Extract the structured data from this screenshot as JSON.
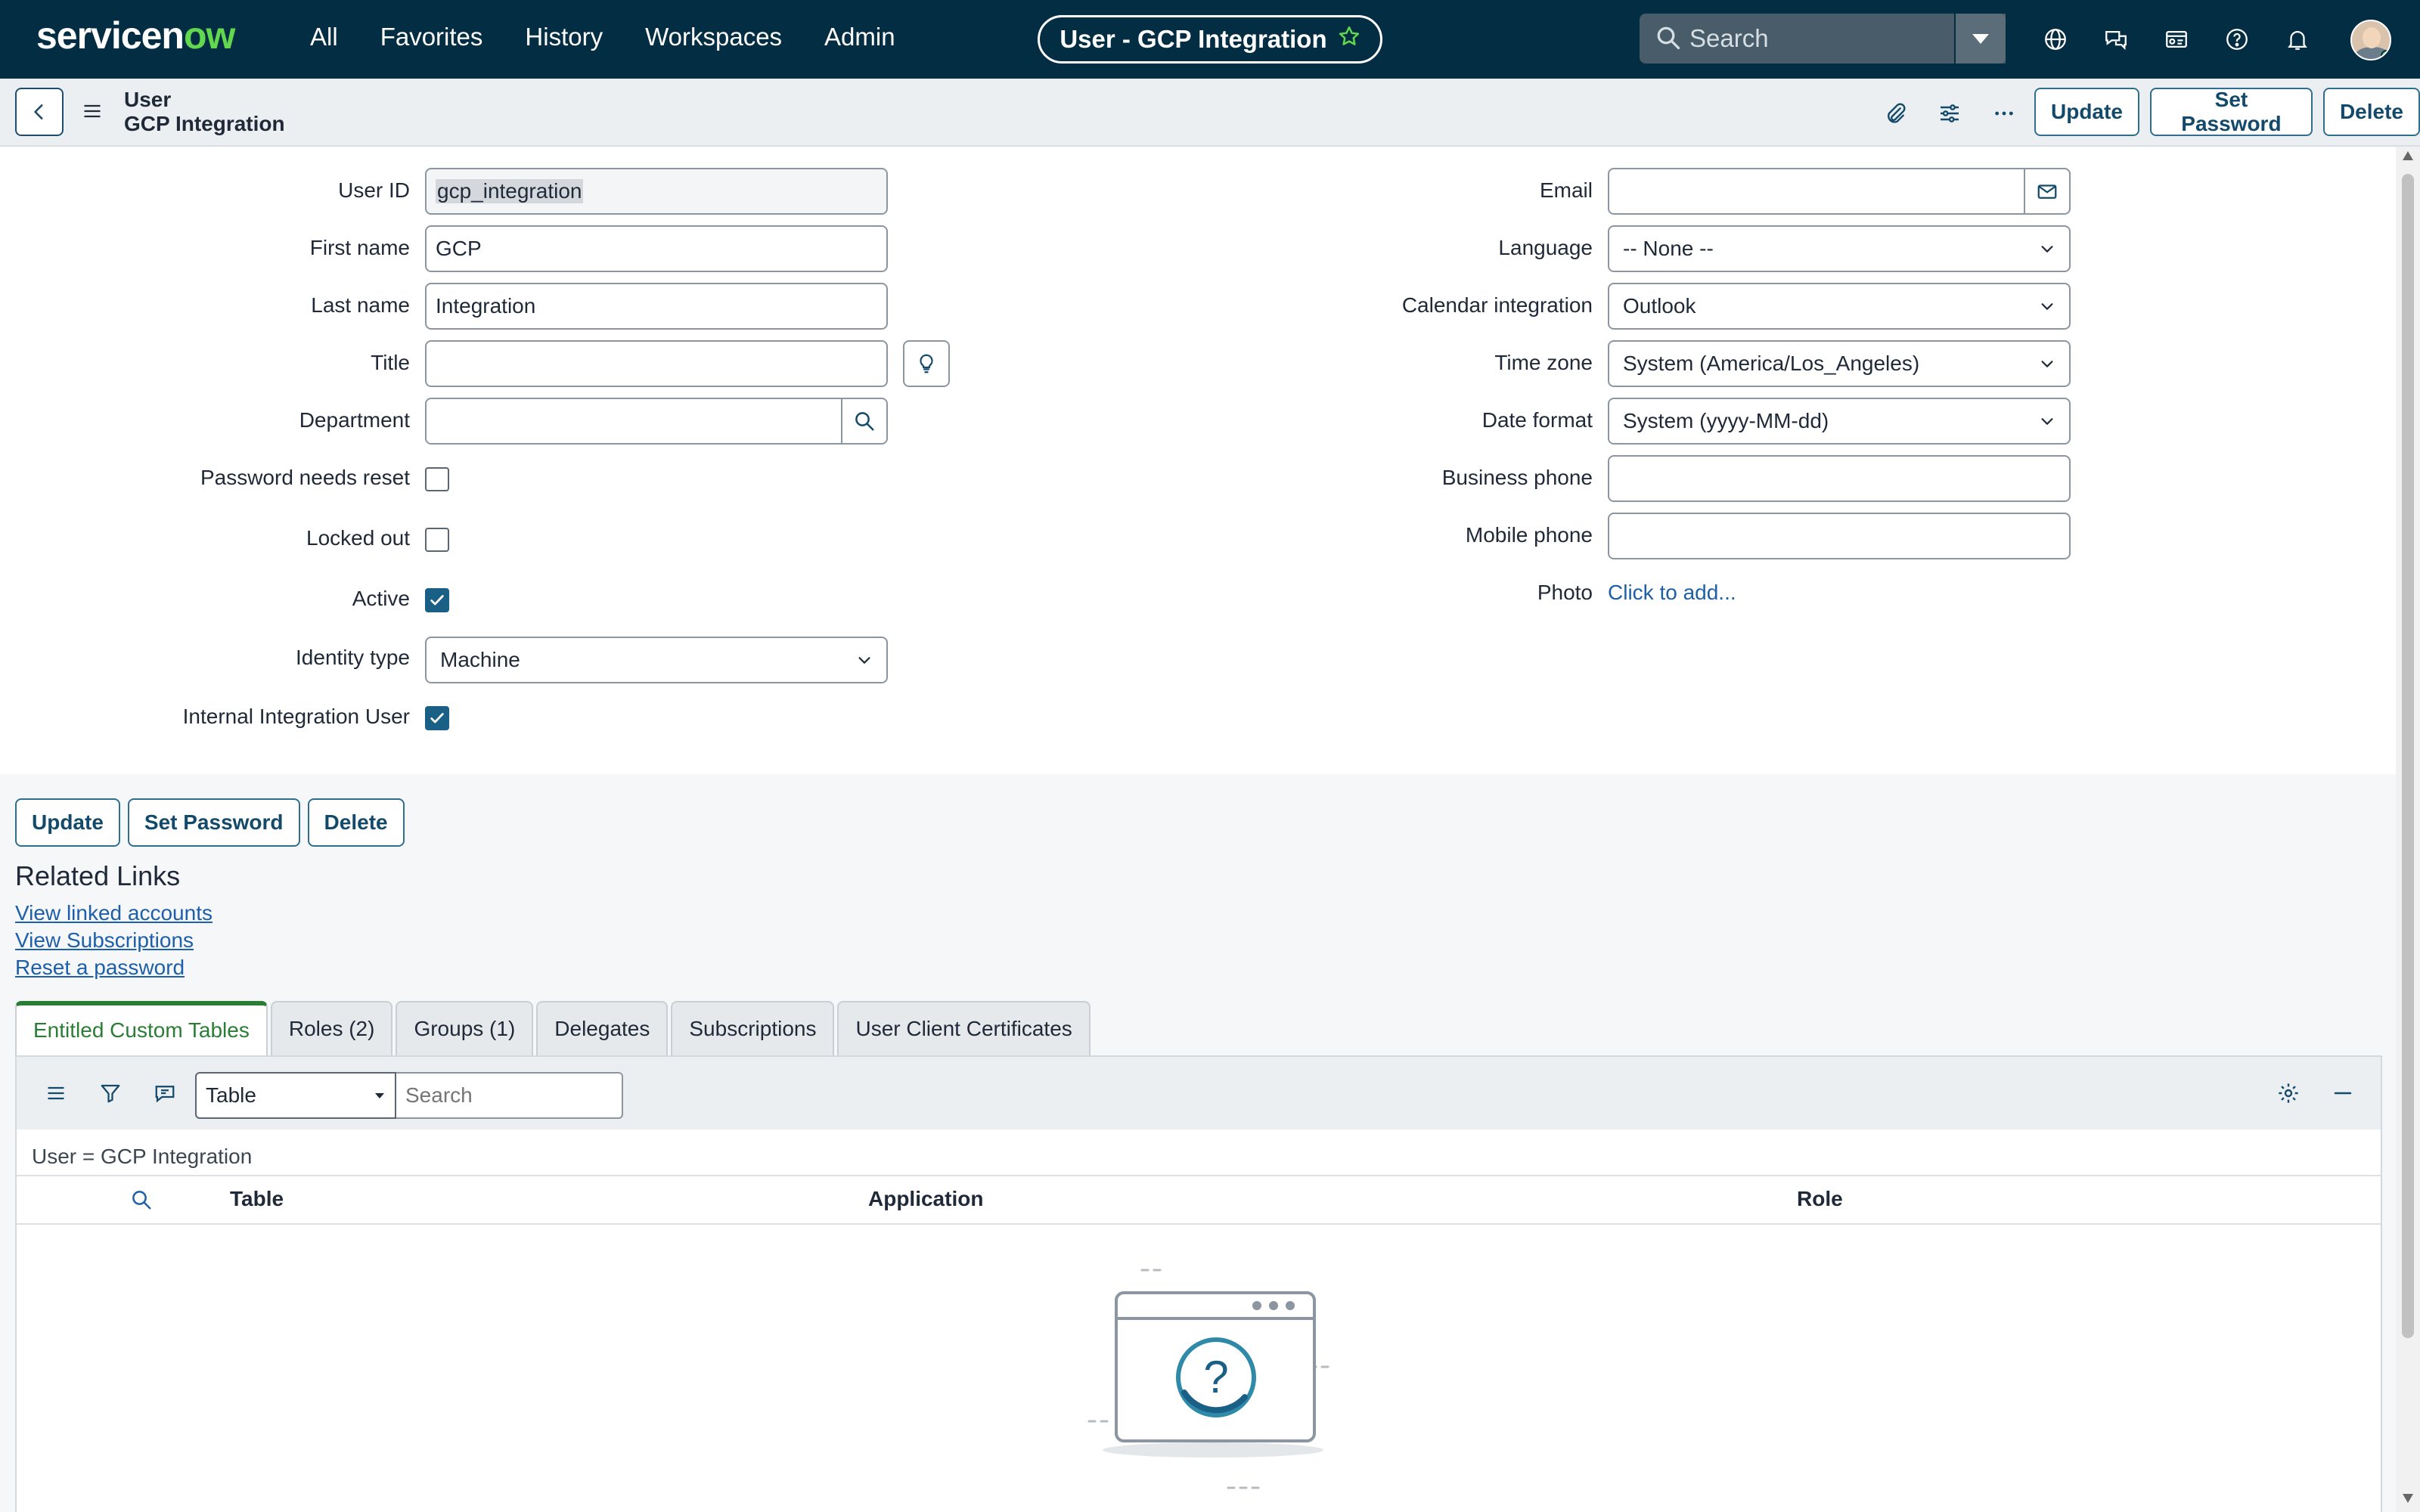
{
  "colors": {
    "nav_bg": "#032d42",
    "brand_green": "#62d84e",
    "link": "#1d5fa8",
    "active_tab": "#2b7d36"
  },
  "nav": {
    "logo_text_a": "servicen",
    "logo_text_b": "ow",
    "links": [
      "All",
      "Favorites",
      "History",
      "Workspaces",
      "Admin"
    ],
    "record_pill": "User - GCP Integration",
    "search_placeholder": "Search",
    "icons": [
      "globe-icon",
      "chat-icon",
      "id-card-icon",
      "help-icon",
      "bell-icon"
    ]
  },
  "header": {
    "record_type": "User",
    "record_name": "GCP Integration",
    "buttons": {
      "update": "Update",
      "set_password": "Set Password",
      "delete": "Delete"
    }
  },
  "form": {
    "left": {
      "user_id": {
        "label": "User ID",
        "value": "gcp_integration"
      },
      "first_name": {
        "label": "First name",
        "value": "GCP"
      },
      "last_name": {
        "label": "Last name",
        "value": "Integration"
      },
      "title": {
        "label": "Title",
        "value": ""
      },
      "department": {
        "label": "Department",
        "value": ""
      },
      "password_needs_reset": {
        "label": "Password needs reset",
        "checked": false
      },
      "locked_out": {
        "label": "Locked out",
        "checked": false
      },
      "active": {
        "label": "Active",
        "checked": true
      },
      "identity_type": {
        "label": "Identity type",
        "value": "Machine"
      },
      "internal_integration_user": {
        "label": "Internal Integration User",
        "checked": true
      }
    },
    "right": {
      "email": {
        "label": "Email",
        "value": ""
      },
      "language": {
        "label": "Language",
        "value": "-- None --"
      },
      "calendar_integration": {
        "label": "Calendar integration",
        "value": "Outlook"
      },
      "time_zone": {
        "label": "Time zone",
        "value": "System (America/Los_Angeles)"
      },
      "date_format": {
        "label": "Date format",
        "value": "System (yyyy-MM-dd)"
      },
      "business_phone": {
        "label": "Business phone",
        "value": ""
      },
      "mobile_phone": {
        "label": "Mobile phone",
        "value": ""
      },
      "photo": {
        "label": "Photo",
        "link": "Click to add..."
      }
    }
  },
  "footer_buttons": {
    "update": "Update",
    "set_password": "Set Password",
    "delete": "Delete"
  },
  "related_links": {
    "title": "Related Links",
    "links": [
      "View linked accounts",
      "View Subscriptions",
      "Reset a password"
    ]
  },
  "tabs": [
    {
      "label": "Entitled Custom Tables",
      "active": true
    },
    {
      "label": "Roles (2)",
      "active": false
    },
    {
      "label": "Groups (1)",
      "active": false
    },
    {
      "label": "Delegates",
      "active": false
    },
    {
      "label": "Subscriptions",
      "active": false
    },
    {
      "label": "User Client Certificates",
      "active": false
    }
  ],
  "list": {
    "filter_field": "Table",
    "search_placeholder": "Search",
    "breadcrumb": "User = GCP Integration",
    "columns": [
      "Table",
      "Application",
      "Role"
    ]
  }
}
